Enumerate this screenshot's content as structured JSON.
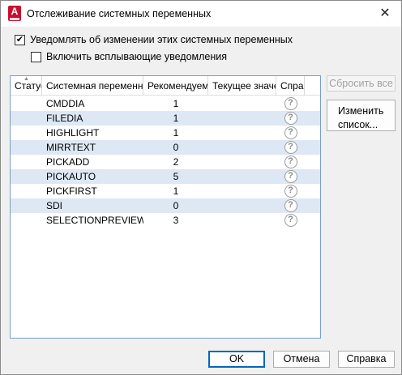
{
  "window": {
    "title": "Отслеживание системных переменных",
    "close_glyph": "✕",
    "app_icon_letter": "A"
  },
  "options": {
    "notify_label": "Уведомлять об изменении этих системных переменных",
    "notify_checked": true,
    "popup_label": "Включить всплывающие уведомления",
    "popup_checked": false
  },
  "grid": {
    "columns": [
      "Статус",
      "Системная переменная",
      "Рекомендуемое",
      "Текущее значение",
      "Справка"
    ],
    "rows": [
      {
        "name": "CMDDIA",
        "recommended": "1",
        "current": ""
      },
      {
        "name": "FILEDIA",
        "recommended": "1",
        "current": ""
      },
      {
        "name": "HIGHLIGHT",
        "recommended": "1",
        "current": ""
      },
      {
        "name": "MIRRTEXT",
        "recommended": "0",
        "current": ""
      },
      {
        "name": "PICKADD",
        "recommended": "2",
        "current": ""
      },
      {
        "name": "PICKAUTO",
        "recommended": "5",
        "current": ""
      },
      {
        "name": "PICKFIRST",
        "recommended": "1",
        "current": ""
      },
      {
        "name": "SDI",
        "recommended": "0",
        "current": ""
      },
      {
        "name": "SELECTIONPREVIEW",
        "recommended": "3",
        "current": ""
      }
    ],
    "help_glyph": "?"
  },
  "side_buttons": {
    "reset_all": "Сбросить все",
    "edit_list_line1": "Изменить",
    "edit_list_line2": "список..."
  },
  "footer": {
    "ok": "OK",
    "cancel": "Отмена",
    "help": "Справка"
  },
  "colors": {
    "row_alt": "#dde8f4",
    "accent": "#0067c0",
    "app_icon": "#c8102e"
  }
}
